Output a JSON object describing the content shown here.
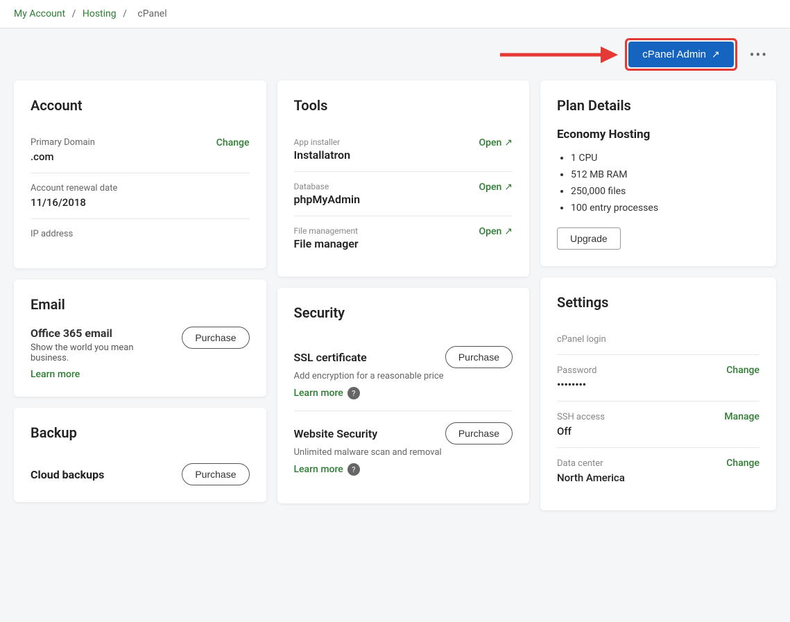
{
  "breadcrumb": {
    "my_account": "My Account",
    "hosting": "Hosting",
    "cpanel": "cPanel"
  },
  "header": {
    "cpanel_btn": "cPanel Admin",
    "more_options": "•••"
  },
  "account": {
    "title": "Account",
    "primary_domain_label": "Primary Domain",
    "primary_domain_value": ".com",
    "primary_domain_action": "Change",
    "renewal_date_label": "Account renewal date",
    "renewal_date_value": "11/16/2018",
    "ip_label": "IP address",
    "ip_value": ""
  },
  "tools": {
    "title": "Tools",
    "app_installer_label": "App installer",
    "app_installer_name": "Installatron",
    "app_installer_action": "Open",
    "database_label": "Database",
    "database_name": "phpMyAdmin",
    "database_action": "Open",
    "file_mgmt_label": "File management",
    "file_mgmt_name": "File manager",
    "file_mgmt_action": "Open"
  },
  "plan_details": {
    "title": "Plan Details",
    "plan_name": "Economy Hosting",
    "features": [
      "1 CPU",
      "512 MB RAM",
      "250,000 files",
      "100 entry processes"
    ],
    "upgrade_label": "Upgrade"
  },
  "email": {
    "title": "Email",
    "product_name": "Office 365 email",
    "product_desc_line1": "Show the world you mean",
    "product_desc_line2": "business.",
    "learn_more": "Learn more",
    "purchase_label": "Purchase"
  },
  "security": {
    "title": "Security",
    "ssl_title": "SSL certificate",
    "ssl_desc": "Add encryption for a reasonable price",
    "ssl_learn_more": "Learn more",
    "ssl_purchase": "Purchase",
    "website_security_title": "Website Security",
    "website_security_desc": "Unlimited malware scan and removal",
    "website_security_learn_more": "Learn more",
    "website_security_purchase": "Purchase"
  },
  "backup": {
    "title": "Backup",
    "cloud_backups_label": "Cloud backups",
    "cloud_backups_purchase": "Purchase"
  },
  "settings": {
    "title": "Settings",
    "cpanel_login_label": "cPanel login",
    "cpanel_login_value": "",
    "password_label": "Password",
    "password_value": "••••••••",
    "password_action": "Change",
    "ssh_label": "SSH access",
    "ssh_value": "Off",
    "ssh_action": "Manage",
    "data_center_label": "Data center",
    "data_center_value": "North America",
    "data_center_action": "Change"
  }
}
